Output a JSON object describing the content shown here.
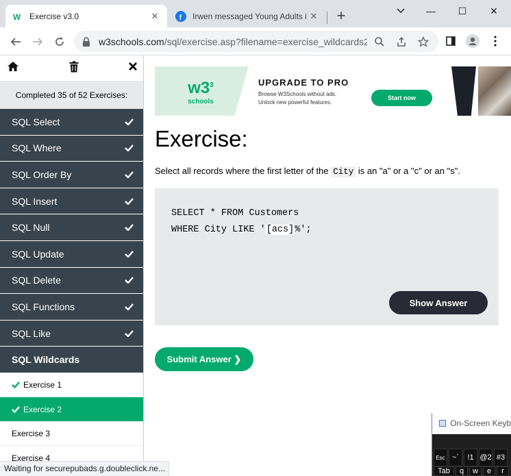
{
  "browser": {
    "tabs": [
      {
        "title": "Exercise v3.0",
        "active": true
      },
      {
        "title": "Irwen messaged Young Adults i",
        "active": false
      }
    ],
    "new_tab": "+",
    "url_prefix": "w3schools.com",
    "url_path": "/sql/exercise.asp?filename=exercise_wildcards2",
    "window_controls": {
      "minimize": "—",
      "maximize": "☐",
      "close": "✕"
    },
    "status_text": "Waiting for securepubads.g.doubleclick.ne..."
  },
  "sidebar": {
    "progress": "Completed 35 of 52 Exercises:",
    "categories": [
      {
        "label": "SQL Select",
        "done": true
      },
      {
        "label": "SQL Where",
        "done": true
      },
      {
        "label": "SQL Order By",
        "done": true
      },
      {
        "label": "SQL Insert",
        "done": true
      },
      {
        "label": "SQL Null",
        "done": true
      },
      {
        "label": "SQL Update",
        "done": true
      },
      {
        "label": "SQL Delete",
        "done": true
      },
      {
        "label": "SQL Functions",
        "done": true
      },
      {
        "label": "SQL Like",
        "done": true
      },
      {
        "label": "SQL Wildcards",
        "done": false
      }
    ],
    "exercises": [
      {
        "label": "Exercise 1",
        "done": true,
        "active": false
      },
      {
        "label": "Exercise 2",
        "done": true,
        "active": true
      },
      {
        "label": "Exercise 3",
        "done": false,
        "active": false
      },
      {
        "label": "Exercise 4",
        "done": false,
        "active": false
      }
    ]
  },
  "ad": {
    "logo": "w3",
    "logo_sup": "3",
    "logo_sub": "schools",
    "title": "UPGRADE TO PRO",
    "line1": "Browse W3Schools without ads.",
    "line2": "Unlock new powerful features.",
    "button": "Start now"
  },
  "main": {
    "heading": "Exercise:",
    "instruction_before": "Select all records where the first letter of the ",
    "instruction_code": "City",
    "instruction_after": " is an \"a\" or a \"c\" or an \"s\".",
    "code_line1": "SELECT * FROM Customers",
    "code_line2_before": "WHERE City LIKE '",
    "code_input_value": "[acs]",
    "code_line2_after": "%';",
    "show_answer": "Show Answer",
    "submit": "Submit Answer ❯"
  },
  "osk": {
    "title": "On-Screen Keyb",
    "row1": [
      "Esc",
      "~`",
      "!1",
      "@2",
      "#3"
    ],
    "row2": [
      "Tab",
      "q",
      "w",
      "e",
      "r"
    ]
  },
  "colors": {
    "accent": "#04aa6d",
    "sidebar_dark": "#38444d",
    "code_bg": "#e7e9eb",
    "button_dark": "#282a35"
  }
}
